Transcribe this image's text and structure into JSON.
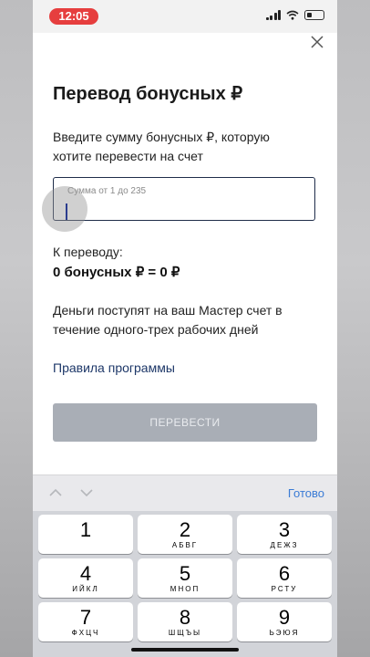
{
  "status_bar": {
    "time": "12:05"
  },
  "dialog": {
    "title": "Перевод бонусных ₽",
    "description": "Введите сумму бонусных ₽, которую хотите перевести на счет",
    "input_placeholder": "Сумма от 1 до 235",
    "input_value": "",
    "transfer_label": "К переводу:",
    "transfer_value": "0 бонусных ₽ = 0 ₽",
    "note": "Деньги поступят на ваш Мастер счет в течение одного-трех рабочих дней",
    "rules_link": "Правила программы",
    "submit_button": "ПЕРЕВЕСТИ"
  },
  "keyboard_toolbar": {
    "done_label": "Готово"
  },
  "keyboard": {
    "keys": [
      {
        "digit": "1",
        "letters": ""
      },
      {
        "digit": "2",
        "letters": "АБВГ"
      },
      {
        "digit": "3",
        "letters": "ДЕЖЗ"
      },
      {
        "digit": "4",
        "letters": "ИЙКЛ"
      },
      {
        "digit": "5",
        "letters": "МНОП"
      },
      {
        "digit": "6",
        "letters": "РСТУ"
      },
      {
        "digit": "7",
        "letters": "ФХЦЧ"
      },
      {
        "digit": "8",
        "letters": "ШЩЪЫ"
      },
      {
        "digit": "9",
        "letters": "ЬЭЮЯ"
      }
    ]
  },
  "colors": {
    "accent": "#1d3768",
    "status_pill": "#e63e3e",
    "disabled_button": "#a9aeb6",
    "done": "#3a7bd5"
  }
}
